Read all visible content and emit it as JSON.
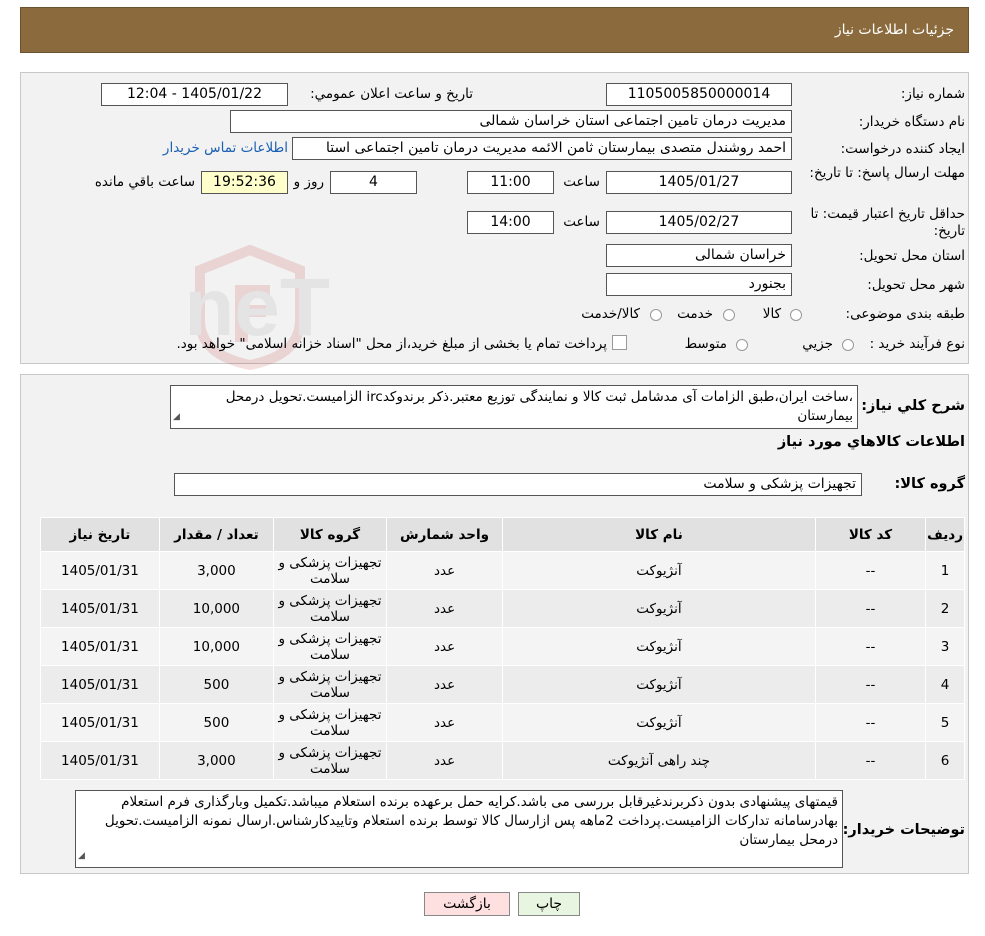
{
  "header": {
    "title": "جزئیات اطلاعات نیاز"
  },
  "labels": {
    "need_number": "شماره نیاز:",
    "announce_datetime": "تاریخ و ساعت اعلان عمومي:",
    "buyer_org": "نام دستگاه خریدار:",
    "requester": "ایجاد کننده درخواست:",
    "reply_deadline": "مهلت ارسال پاسخ: تا تاریخ:",
    "time": "ساعت",
    "days_and": "روز و",
    "remaining": "ساعت باقي مانده",
    "price_validity": "حداقل تاریخ اعتبار قیمت: تا تاریخ:",
    "delivery_province": "استان محل تحویل:",
    "delivery_city": "شهر محل تحویل:",
    "category": "طبقه بندی موضوعی:",
    "process_type": "نوع فرآیند خرید :",
    "description": "شرح کلي نیاز:",
    "items_section": "اطلاعات کالاهاي مورد نیاز",
    "goods_group": "گروه کالا:",
    "buyer_notes": "توضیحات خریدار:"
  },
  "fields": {
    "need_number": "1105005850000014",
    "announce_datetime": "1405/01/22 - 12:04",
    "buyer_org": "مدیریت درمان تامین اجتماعی استان خراسان شمالی",
    "requester": "احمد روشندل متصدی بیمارستان ثامن الائمه مدیریت درمان تامین اجتماعی استا",
    "contact_link": "اطلاعات تماس خریدار",
    "reply_date": "1405/01/27",
    "reply_time": "11:00",
    "remaining_days": "4",
    "remaining_time": "19:52:36",
    "validity_date": "1405/02/27",
    "validity_time": "14:00",
    "delivery_province": "خراسان شمالی",
    "delivery_city": "بجنورد",
    "goods_group": "تجهیزات پزشکی و سلامت"
  },
  "category_options": {
    "goods": "کالا",
    "service": "خدمت",
    "goods_service": "کالا/خدمت"
  },
  "process_options": {
    "partial": "جزیي",
    "medium": "متوسط",
    "note": "پرداخت تمام یا بخشی از مبلغ خرید،از محل \"اسناد خزانه اسلامی\" خواهد بود."
  },
  "description_text": "،ساخت ایران،طبق الزامات آی مدشامل ثبت کالا و نمایندگی توزیع معتبر.ذکر برندوکدirc الزامیست.تحویل درمحل بیمارستان",
  "table": {
    "headers": [
      "ردیف",
      "کد کالا",
      "نام کالا",
      "واحد شمارش",
      "گروه کالا",
      "تعداد / مقدار",
      "تاریخ نیاز"
    ],
    "rows": [
      [
        "1",
        "--",
        "آنژیوکت",
        "عدد",
        "تجهیزات پزشکی و سلامت",
        "3,000",
        "1405/01/31"
      ],
      [
        "2",
        "--",
        "آنژیوکت",
        "عدد",
        "تجهیزات پزشکی و سلامت",
        "10,000",
        "1405/01/31"
      ],
      [
        "3",
        "--",
        "آنژیوکت",
        "عدد",
        "تجهیزات پزشکی و سلامت",
        "10,000",
        "1405/01/31"
      ],
      [
        "4",
        "--",
        "آنژیوکت",
        "عدد",
        "تجهیزات پزشکی و سلامت",
        "500",
        "1405/01/31"
      ],
      [
        "5",
        "--",
        "آنژیوکت",
        "عدد",
        "تجهیزات پزشکی و سلامت",
        "500",
        "1405/01/31"
      ],
      [
        "6",
        "--",
        "چند راهی آنژیوکت",
        "عدد",
        "تجهیزات پزشکی و سلامت",
        "3,000",
        "1405/01/31"
      ]
    ]
  },
  "buyer_notes_text": "قیمتهای پیشنهادی بدون ذکربرندغیرقابل بررسی می باشد.کرایه حمل برعهده برنده استعلام میباشد.تکمیل وبارگذاری فرم استعلام بهادرسامانه تدارکات الزامیست.پرداخت 2ماهه پس ازارسال کالا توسط برنده استعلام وتاییدکارشناس.ارسال نمونه الزامیست.تحویل درمحل بیمارستان",
  "buttons": {
    "print": "چاپ",
    "back": "بازگشت"
  },
  "watermark_text": "AriaTender.neT",
  "colors": {
    "header_bg": "#8b6b3d",
    "link": "#1a5fb4",
    "back_button": "#ffe0e0",
    "print_button": "#e8f5e0"
  }
}
